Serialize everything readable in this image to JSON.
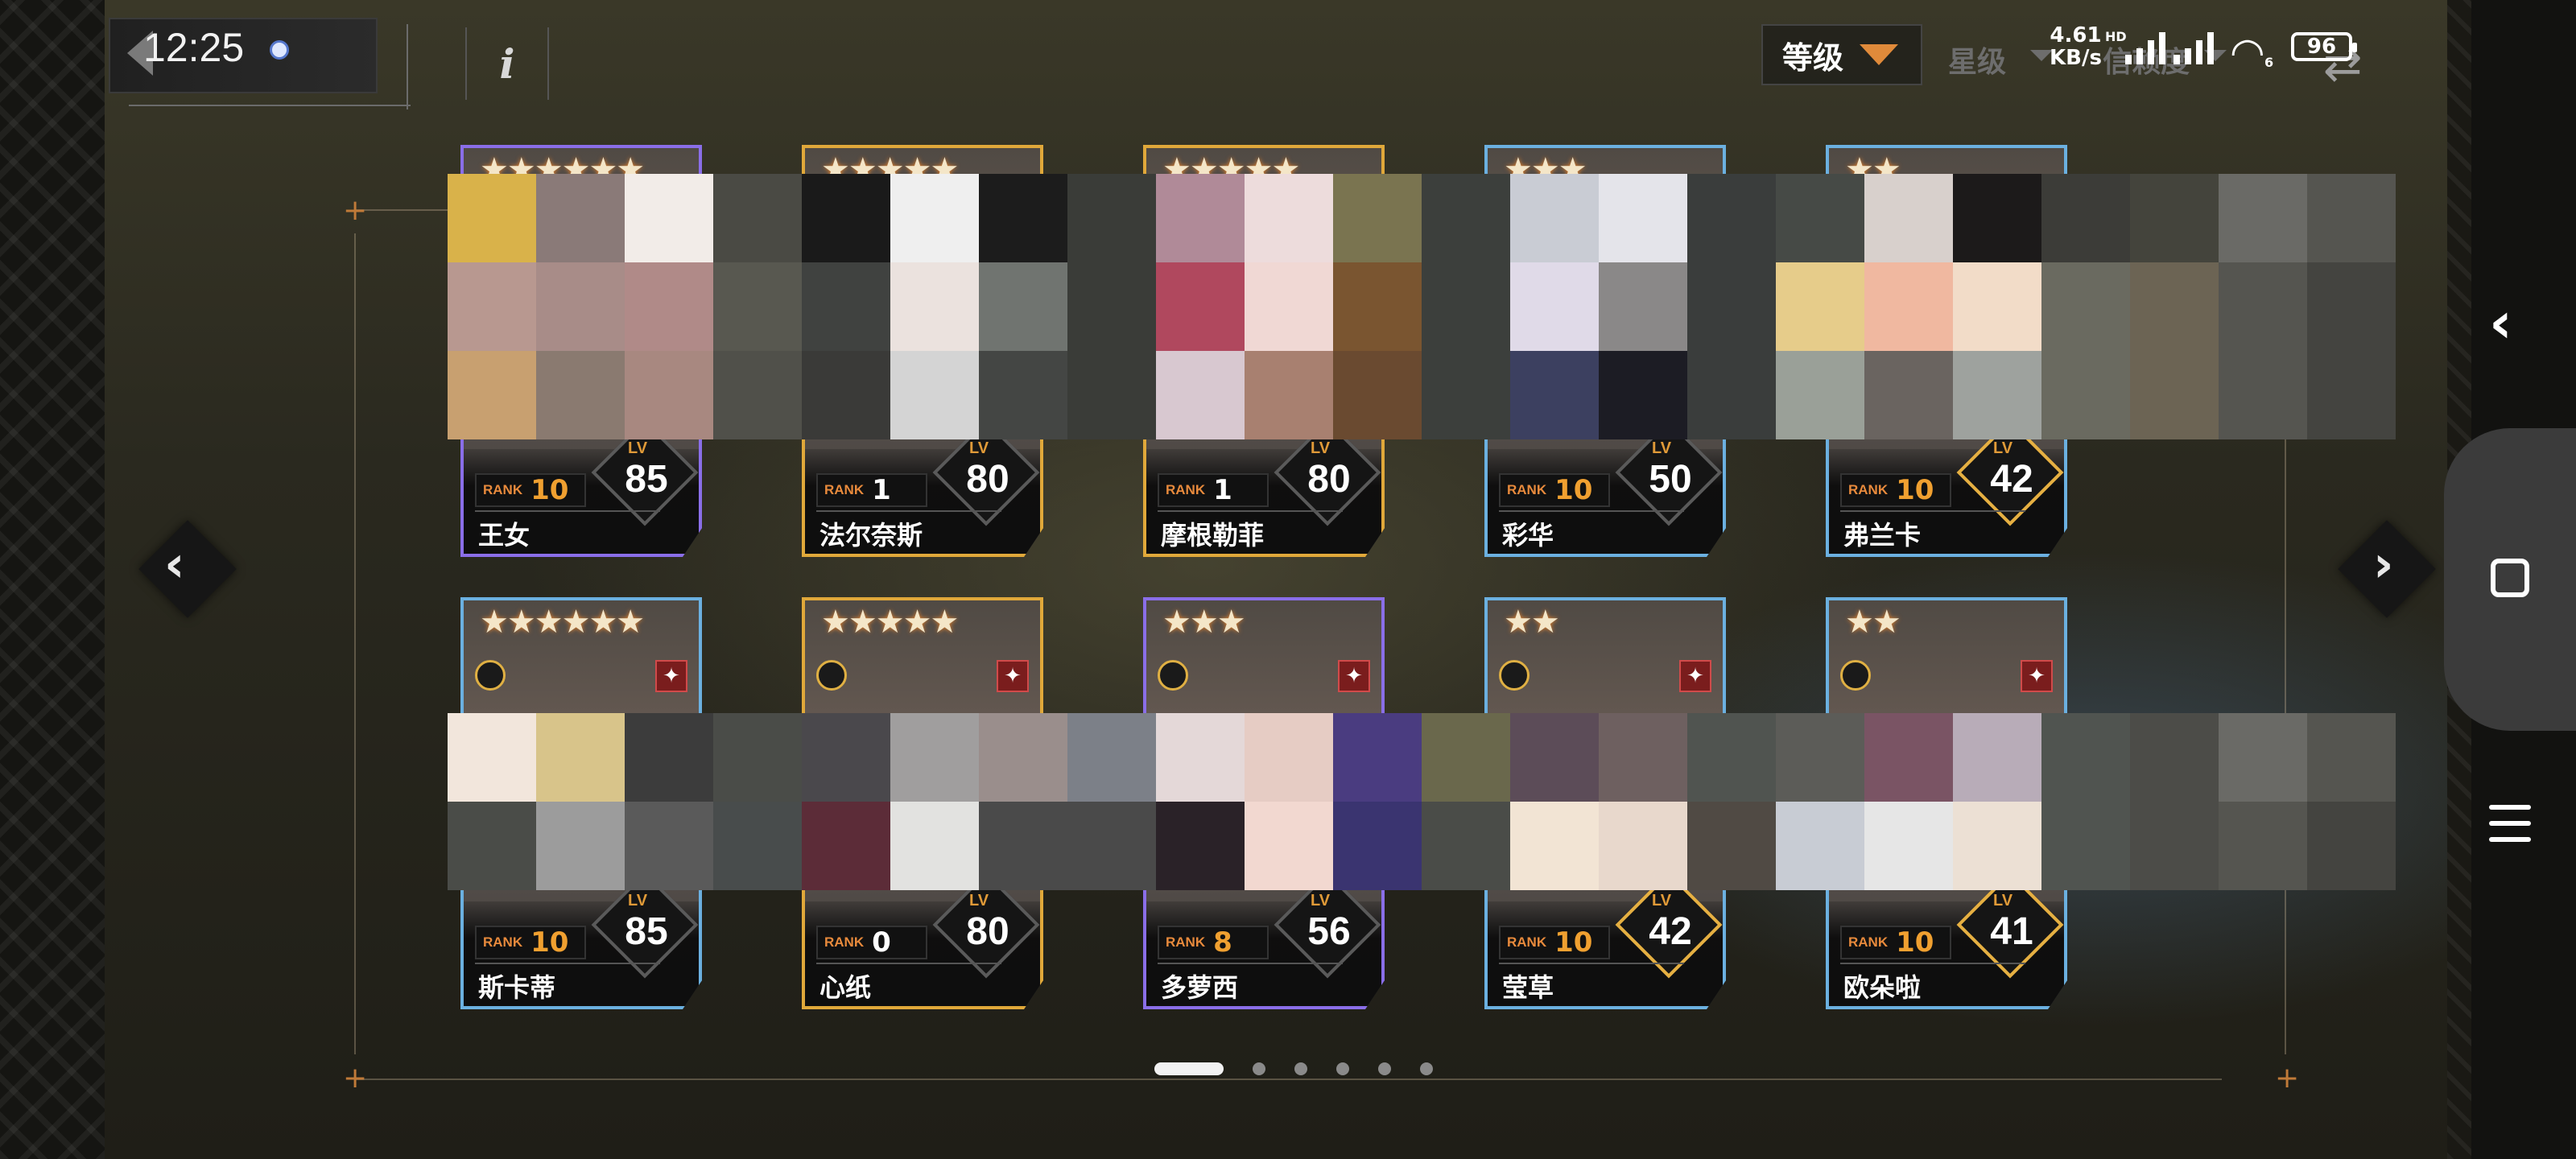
{
  "status": {
    "time": "12:25",
    "net_speed_value": "4.61",
    "net_speed_unit": "KB/s",
    "hd_label": "HD",
    "wifi_label": "6",
    "battery": "96"
  },
  "header": {
    "info_label": "i",
    "sort_level_label": "等级",
    "sort_star_label": "星级",
    "sort_trust_label": "信赖度",
    "swap_icon": "swap-arrows-icon",
    "accent_color": "#e08a3a"
  },
  "rank_label": "RANK",
  "lv_label": "LV",
  "cards": [
    {
      "name": "王女",
      "rank": "10",
      "level": "85",
      "stars": "★★★★★★",
      "rarity": "purple"
    },
    {
      "name": "法尔奈斯",
      "rank": "1",
      "level": "80",
      "stars": "★★★★★",
      "rarity": "gold"
    },
    {
      "name": "摩根勒菲",
      "rank": "1",
      "level": "80",
      "stars": "★★★★★",
      "rarity": "gold"
    },
    {
      "name": "彩华",
      "rank": "10",
      "level": "50",
      "stars": "★★★",
      "rarity": "blue"
    },
    {
      "name": "弗兰卡",
      "rank": "10",
      "level": "42",
      "stars": "★★",
      "rarity": "blue"
    },
    {
      "name": "斯卡蒂",
      "rank": "10",
      "level": "85",
      "stars": "★★★★★★",
      "rarity": "blue"
    },
    {
      "name": "心纸",
      "rank": "0",
      "level": "80",
      "stars": "★★★★★",
      "rarity": "gold"
    },
    {
      "name": "多萝西",
      "rank": "8",
      "level": "56",
      "stars": "★★★",
      "rarity": "purple"
    },
    {
      "name": "莹草",
      "rank": "10",
      "level": "42",
      "stars": "★★",
      "rarity": "blue"
    },
    {
      "name": "欧朵啦",
      "rank": "10",
      "level": "41",
      "stars": "★★",
      "rarity": "blue"
    }
  ],
  "pagination": {
    "pages": 6,
    "active": 1
  },
  "colors": {
    "rank_orange": "#f0a030",
    "purple_frame": "#8a6ee8",
    "gold_frame": "#e0a83a",
    "blue_frame": "#6bb0e0"
  }
}
